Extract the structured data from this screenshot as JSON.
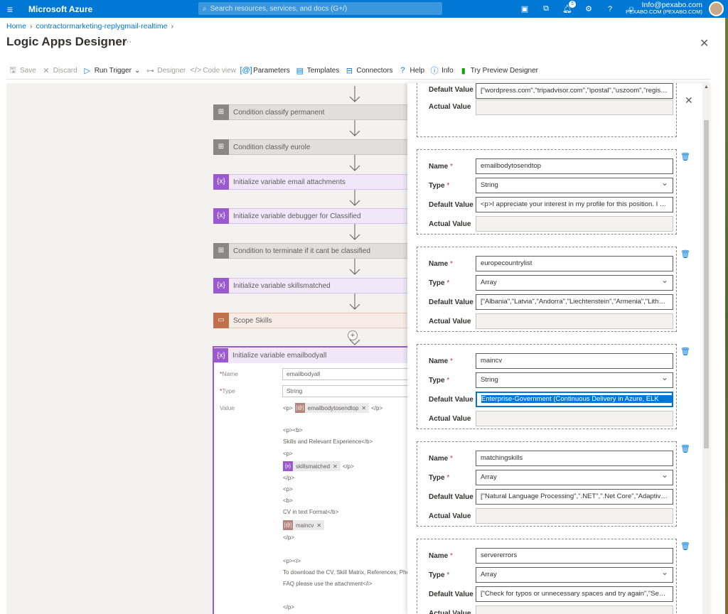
{
  "topbar": {
    "menu_icon": "hamburger-icon",
    "brand": "Microsoft Azure",
    "search_placeholder": "Search resources, services, and docs (G+/)",
    "notification_count": "5",
    "account_email": "Info@pexabo.com",
    "account_org": "PEXABO.COM (PEXABO.COM)"
  },
  "breadcrumb": {
    "home": "Home",
    "resource": "contractormarketing-replygmail-realtime"
  },
  "page": {
    "title": "Logic Apps Designer",
    "more": "···"
  },
  "toolbar": {
    "save": "Save",
    "discard": "Discard",
    "run_trigger": "Run Trigger",
    "designer": "Designer",
    "code_view": "Code view",
    "parameters": "Parameters",
    "templates": "Templates",
    "connectors": "Connectors",
    "help": "Help",
    "info": "Info",
    "try_preview": "Try Preview Designer"
  },
  "canvas": {
    "steps": [
      {
        "label": "Condition classify permanent",
        "kind": "condition"
      },
      {
        "label": "Condition classify eurole",
        "kind": "condition"
      },
      {
        "label": "Initialize variable email attachments",
        "kind": "variable"
      },
      {
        "label": "Initialize variable debugger for Classified",
        "kind": "variable"
      },
      {
        "label": "Condition to terminate if it cant be classified",
        "kind": "condition"
      },
      {
        "label": "Initialize variable skillsmatched",
        "kind": "variable"
      },
      {
        "label": "Scope Skills",
        "kind": "scope"
      }
    ],
    "expanded": {
      "title": "Initialize variable emailbodyall",
      "name_label": "Name",
      "name_value": "emailbodyall",
      "type_label": "Type",
      "type_value": "String",
      "value_label": "Value",
      "value_lines": {
        "l1_pre": "<p>",
        "l1_token": "emailbodytosendtop",
        "l1_post": "</p>",
        "l2": "<p><b>",
        "l3": "Skills and Relevant Experience</b>",
        "l4": "<p>",
        "l5_token": "skillsmatched",
        "l5_post": "</p>",
        "l6": "</p>",
        "l7": "<p>",
        "l8": "<b>",
        "l9": "CV in text Format</b>",
        "l10_token": "maincv",
        "l11": "</p>",
        "l12": "<p><i>",
        "l13": "To download the CV, Skill Matrix, References, Pho",
        "l14": "FAQ please use the attachment</i>",
        "l15": "</p>"
      }
    }
  },
  "panel": {
    "labels": {
      "name": "Name",
      "type": "Type",
      "default": "Default Value",
      "actual": "Actual Value",
      "required": "*"
    },
    "top_partial": {
      "default_label": "Default Value",
      "default_value": "[\"wordpress.com\",\"tripadvisor.com\",\"ipostal\",\"uszoom\",\"registe..."
    },
    "params": [
      {
        "name": "emailbodytosendtop",
        "type": "String",
        "default": "<p>I appreciate your interest in my profile for this position. I w..."
      },
      {
        "name": "europecountrylist",
        "type": "Array",
        "default": "[\"Albania\",\"Latvia\",\"Andorra\",\"Liechtenstein\",\"Armenia\",\"Lithua..."
      },
      {
        "name": "maincv",
        "type": "String",
        "default": "Enterprise-Government (Continuous Delivery in Azure, ELK), Glase"
      },
      {
        "name": "matchingskills",
        "type": "Array",
        "default": "[\"Natural Language Processing\",\".NET\",\".Net Core\",\"Adaptive S..."
      },
      {
        "name": "servererrors",
        "type": "Array",
        "default": "[\"Check for typos or unnecessary spaces and try again\",\"See th..."
      }
    ]
  }
}
